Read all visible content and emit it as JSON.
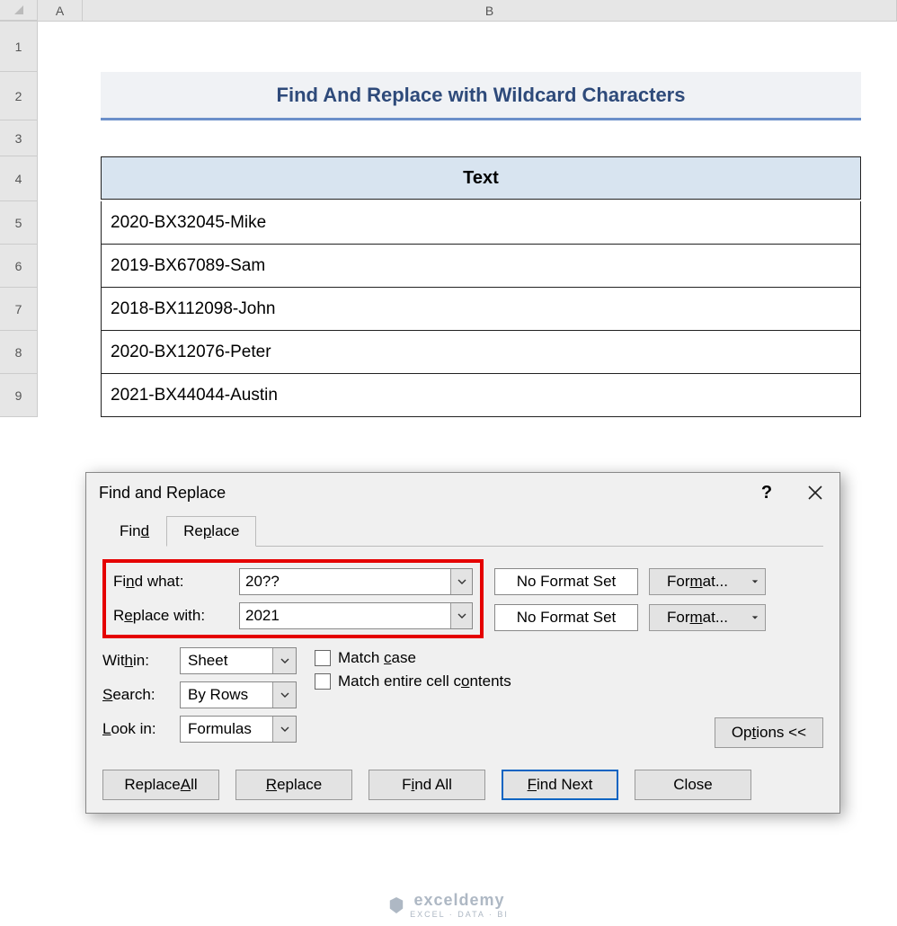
{
  "columns": [
    "A",
    "B"
  ],
  "rows": [
    "1",
    "2",
    "3",
    "4",
    "5",
    "6",
    "7",
    "8",
    "9"
  ],
  "title": "Find And Replace with Wildcard Characters",
  "table": {
    "header": "Text",
    "data": [
      "2020-BX32045-Mike",
      "2019-BX67089-Sam",
      "2018-BX112098-John",
      "2020-BX12076-Peter",
      "2021-BX44044-Austin"
    ]
  },
  "dialog": {
    "title": "Find and Replace",
    "tabs": {
      "find": "Find",
      "replace": "Replace"
    },
    "find_what_label": "Find what:",
    "find_what_value": "20??",
    "replace_with_label": "Replace with:",
    "replace_with_value": "2021",
    "no_format": "No Format Set",
    "format_btn": "Format...",
    "within_label": "Within:",
    "within_value": "Sheet",
    "search_label": "Search:",
    "search_value": "By Rows",
    "lookin_label": "Look in:",
    "lookin_value": "Formulas",
    "match_case": "Match case",
    "match_entire": "Match entire cell contents",
    "options_btn": "Options <<",
    "buttons": {
      "replace_all": "Replace All",
      "replace": "Replace",
      "find_all": "Find All",
      "find_next": "Find Next",
      "close": "Close"
    }
  },
  "watermark": {
    "main": "exceldemy",
    "sub": "EXCEL · DATA · BI"
  }
}
